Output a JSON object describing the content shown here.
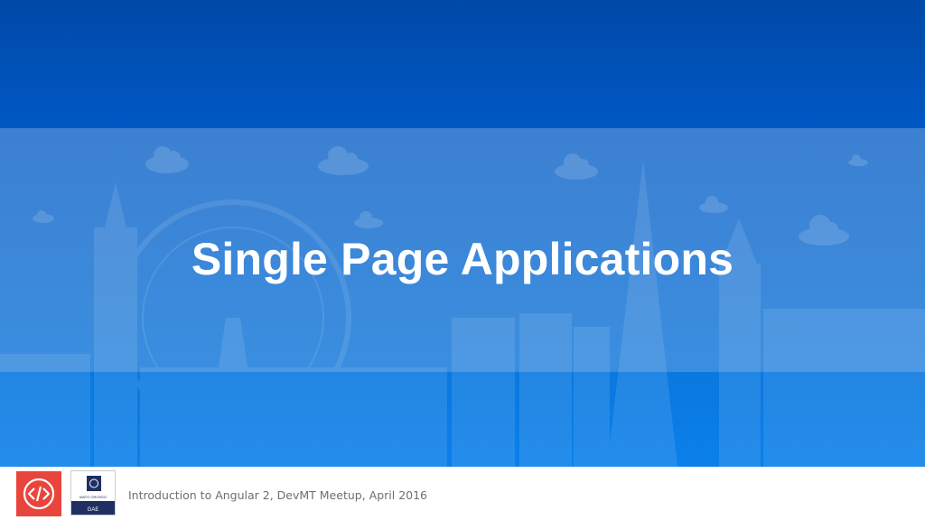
{
  "slide": {
    "title": "Single Page Applications",
    "footer_text": "Introduction to Angular 2, DevMT Meetup, April 2016"
  },
  "logos": {
    "devmt": {
      "glyph": "</>",
      "icon": "code-brackets-icon",
      "color": "#e8453c"
    },
    "gae": {
      "small_text": "MATO GROSSO",
      "label": "GAE",
      "icon": "university-emblem-icon",
      "color": "#1f2f62"
    }
  },
  "colors": {
    "top": "#0049a8",
    "band": "#3a8ee0",
    "bottom": "#0b80ea"
  }
}
